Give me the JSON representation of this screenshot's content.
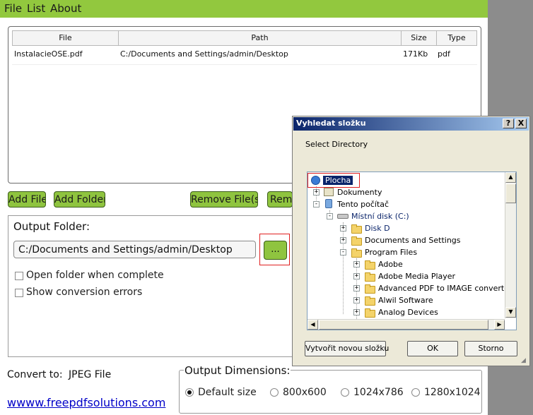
{
  "menu": [
    "File",
    "List",
    "About"
  ],
  "table": {
    "headers": [
      "File",
      "Path",
      "Size",
      "Type"
    ],
    "rows": [
      {
        "file": "InstalacieOSE.pdf",
        "path": "C:/Documents and Settings/admin/Desktop",
        "size": "171Kb",
        "type": "pdf"
      }
    ]
  },
  "toolbar": {
    "add_file": "Add File",
    "add_folder": "Add Folder",
    "remove_files": "Remove File(s)",
    "remove_all": "Remo"
  },
  "output": {
    "label": "Output Folder:",
    "path": "C:/Documents and Settings/admin/Desktop",
    "browse": "...",
    "open_folder": "Open folder when complete",
    "show_errors": "Show conversion errors"
  },
  "convert": {
    "label": "Convert to:",
    "format": "JPEG File"
  },
  "website": "wwww.freepdfsolutions.com",
  "dimensions": {
    "title": "Output Dimensions:",
    "options": [
      "Default size",
      "800x600",
      "1024x786",
      "1280x1024"
    ],
    "selected": "Default size"
  },
  "dialog": {
    "title": "Vyhledat složku",
    "help": "?",
    "close": "X",
    "prompt": "Select Directory",
    "tree": [
      {
        "label": "Plocha",
        "icon": "desktop-icon"
      },
      {
        "label": "Dokumenty",
        "icon": "documents-icon"
      },
      {
        "label": "Tento počítač",
        "icon": "computer-icon"
      },
      {
        "label": "Místní disk (C:)",
        "icon": "drive-icon"
      },
      {
        "label": "Disk D",
        "icon": "folder-icon"
      },
      {
        "label": "Documents and Settings",
        "icon": "folder-icon"
      },
      {
        "label": "Program Files",
        "icon": "folder-icon"
      },
      {
        "label": "Adobe",
        "icon": "folder-icon"
      },
      {
        "label": "Adobe Media Player",
        "icon": "folder-icon"
      },
      {
        "label": "Advanced PDF to IMAGE converter",
        "icon": "folder-icon"
      },
      {
        "label": "Alwil Software",
        "icon": "folder-icon"
      },
      {
        "label": "Analog Devices",
        "icon": "folder-icon"
      }
    ],
    "new_folder": "Vytvořit novou složku",
    "ok": "OK",
    "cancel": "Storno"
  },
  "colors": {
    "accent_green": "#92c83e",
    "highlight_red": "#e02020",
    "title_blue": "#0a246a",
    "link_blue": "#0000c8"
  }
}
